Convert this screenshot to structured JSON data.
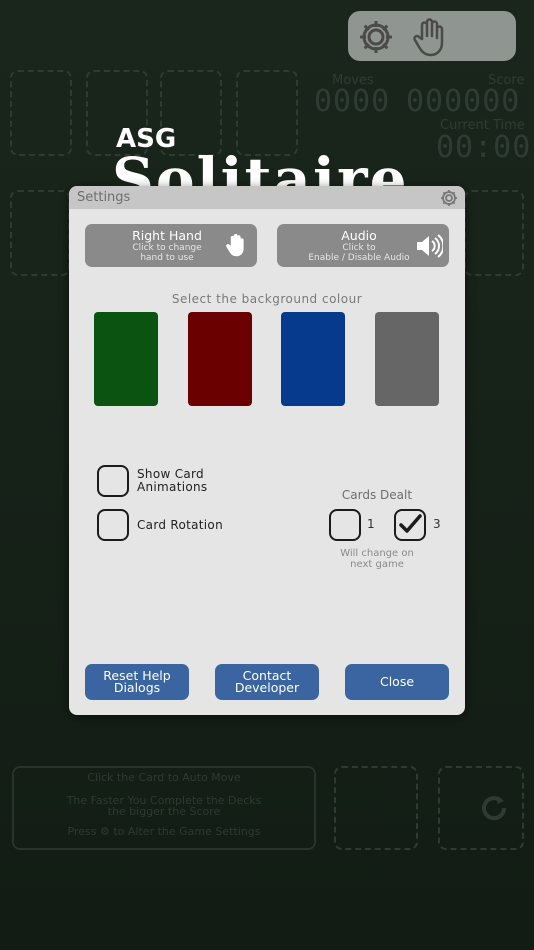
{
  "background": {
    "hud": {
      "moves_label": "Moves",
      "moves_value": "0000",
      "score_label": "Score",
      "score_value": "000000",
      "time_label": "Current Time",
      "time_value": "00:00"
    },
    "logo": {
      "small": "ASG",
      "big": "Solitaire"
    },
    "hints": {
      "line1": "Click the Card to Auto Move",
      "line2": "The Faster You Complete the Decks",
      "line3": "the bigger the Score",
      "line4a": "Press",
      "line4b": "to Alter the Game Settings"
    }
  },
  "dialog": {
    "title": "Settings",
    "hand_button": {
      "title": "Right Hand",
      "line1": "Click to change",
      "line2": "hand to use",
      "icon": "hand-icon"
    },
    "audio_button": {
      "title": "Audio",
      "line1": "Click to",
      "line2": "Enable / Disable Audio",
      "icon": "speaker-icon"
    },
    "bg_label": "Select the background colour",
    "swatches": [
      {
        "name": "green",
        "color": "#0b5311"
      },
      {
        "name": "red",
        "color": "#6b0000"
      },
      {
        "name": "blue",
        "color": "#053a8c"
      },
      {
        "name": "grey",
        "color": "#666666"
      }
    ],
    "show_card_animations": {
      "line1": "Show Card",
      "line2": "Animations",
      "checked": false
    },
    "card_rotation": {
      "label": "Card Rotation",
      "checked": false
    },
    "cards_dealt": {
      "label": "Cards Dealt",
      "option1": {
        "label": "1",
        "checked": false
      },
      "option3": {
        "label": "3",
        "checked": true
      },
      "note_line1": "Will change on",
      "note_line2": "next game"
    },
    "buttons": {
      "reset_line1": "Reset Help",
      "reset_line2": "Dialogs",
      "contact_line1": "Contact",
      "contact_line2": "Developer",
      "close": "Close"
    },
    "accent_color": "#3a65a0"
  }
}
